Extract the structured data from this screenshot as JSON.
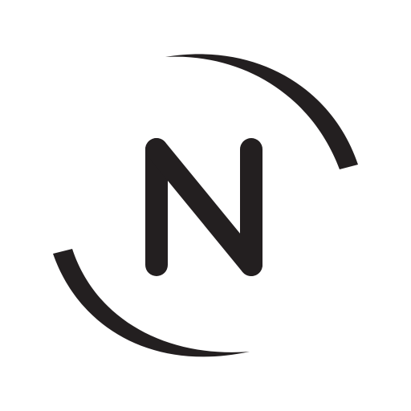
{
  "logo": {
    "letter": "N",
    "icon": "n-circle-swoosh-icon",
    "colors": {
      "background": "#ffffff",
      "mark": "#231f20"
    }
  }
}
